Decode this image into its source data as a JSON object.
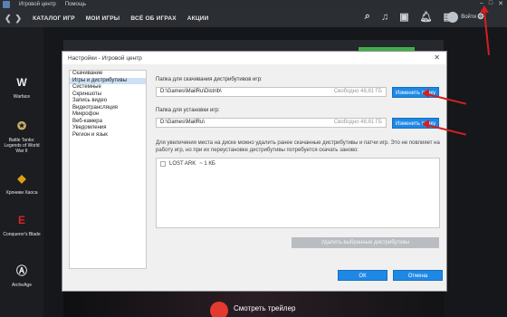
{
  "titlebar": {
    "app_name": "Игровой центр",
    "help": "Помощь"
  },
  "nav": {
    "back": "❮",
    "forward": "❯",
    "items": [
      "КАТАЛОГ ИГР",
      "МОИ ИГРЫ",
      "ВСЁ ОБ ИГРАХ",
      "АКЦИИ"
    ],
    "user_label": "Войти"
  },
  "sidebar": {
    "games": [
      {
        "name": "Warface",
        "icon": "warface-icon"
      },
      {
        "name": "Battle Tanks: Legends of World War II",
        "icon": "battle-tanks-icon"
      },
      {
        "name": "Хроники Хаоса",
        "icon": "chaos-chronicles-icon"
      },
      {
        "name": "Conqueror's Blade",
        "icon": "conquerors-blade-icon"
      },
      {
        "name": "ArcheAge",
        "icon": "archeage-icon"
      }
    ]
  },
  "background": {
    "video_text": "Смотреть трейлер"
  },
  "modal": {
    "title": "Настройки - Игровой центр",
    "categories": [
      "Скачивание",
      "Игры и дистрибутивы",
      "Системные",
      "Скриншоты",
      "Запись видео",
      "Видеотрансляция",
      "Микрофон",
      "Веб-камера",
      "Уведомления",
      "Регион и язык"
    ],
    "active_category": "Игры и дистрибутивы",
    "download_folder": {
      "label": "Папка для скачивания дистрибутивов игр:",
      "value": "D:\\Games\\MailRu\\Distrib\\",
      "free": "Свободно 48,81 ГБ",
      "button": "Изменить папку"
    },
    "install_folder": {
      "label": "Папка для установки игр:",
      "value": "D:\\Games\\MailRu\\",
      "free": "Свободно 48,81 ГБ",
      "button": "Изменить папку"
    },
    "info_text": "Для увеличения места на диске можно удалить ранее скачанные дистрибутивы и патчи игр. Это не повлияет на работу игр, но при их переустановке дистрибутивы потребуется скачать заново:",
    "distributives": [
      {
        "name": "LOST ARK",
        "size": "~ 1 КБ"
      }
    ],
    "delete_button": "Удалить выбранные дистрибутивы",
    "ok_button": "ОК",
    "cancel_button": "Отмена"
  },
  "colors": {
    "accent_blue": "#1e88e5",
    "annotation_red": "#d61f1f",
    "active_category_bg": "#cde0f5"
  }
}
